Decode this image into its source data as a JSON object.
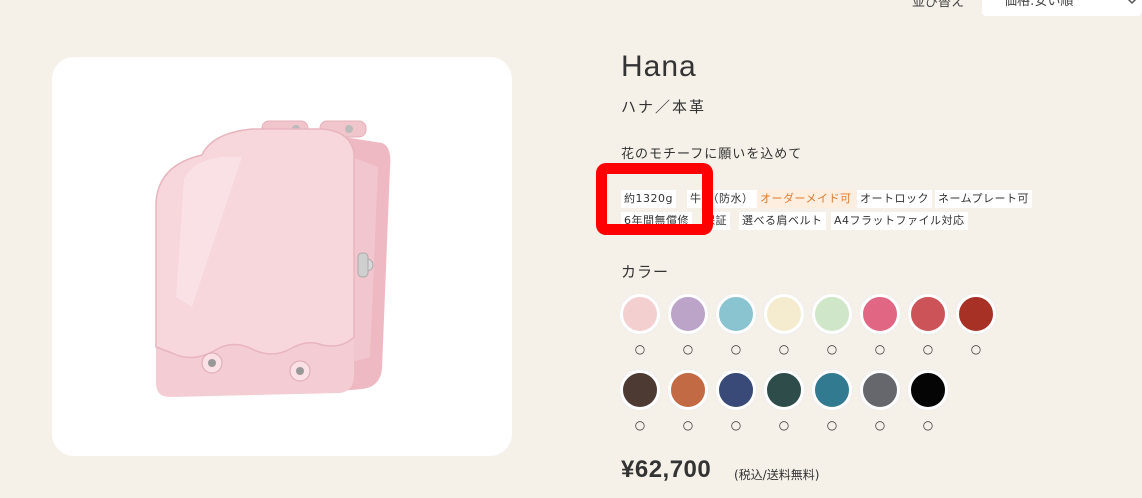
{
  "sort": {
    "label": "並び替え",
    "selected": "価格:安い順"
  },
  "product": {
    "name": "Hana",
    "subname": "ハナ／本革",
    "catch": "花のモチーフに願いを込めて",
    "tags": [
      {
        "label": "約1320g",
        "highlight": false
      },
      {
        "label": "牛　（防水）",
        "highlight": false
      },
      {
        "label": "オーダーメイド可",
        "highlight": true
      },
      {
        "label": "オートロック",
        "highlight": false
      },
      {
        "label": "ネームプレート可",
        "highlight": false
      },
      {
        "label": "6年間無償修",
        "highlight": false
      },
      {
        "label": "保証",
        "highlight": false
      },
      {
        "label": "選べる肩ベルト",
        "highlight": false
      },
      {
        "label": "A4フラットファイル対応",
        "highlight": false
      }
    ],
    "color_heading": "カラー",
    "colors": [
      {
        "hex": "#f3cfd0",
        "mark": "○"
      },
      {
        "hex": "#bca3c8",
        "mark": "○"
      },
      {
        "hex": "#8ac4d0",
        "mark": "○"
      },
      {
        "hex": "#f5ecd0",
        "mark": "○"
      },
      {
        "hex": "#cfe6c8",
        "mark": "○"
      },
      {
        "hex": "#e06684",
        "mark": "○"
      },
      {
        "hex": "#cc5459",
        "mark": "○"
      },
      {
        "hex": "#a83126",
        "mark": "○"
      },
      {
        "hex": "#4d3a33",
        "mark": "○"
      },
      {
        "hex": "#c26a44",
        "mark": "○"
      },
      {
        "hex": "#3a4a78",
        "mark": "○"
      },
      {
        "hex": "#2e4d4a",
        "mark": "○"
      },
      {
        "hex": "#327a90",
        "mark": "○"
      },
      {
        "hex": "#66676d",
        "mark": "○"
      },
      {
        "hex": "#050505",
        "mark": "○"
      }
    ],
    "price": "¥62,700",
    "price_note": "(税込/送料無料)"
  },
  "colors": {
    "background": "#f5f0e8",
    "highlight": "#ff0000",
    "tag_accent": "#e07a2c"
  }
}
